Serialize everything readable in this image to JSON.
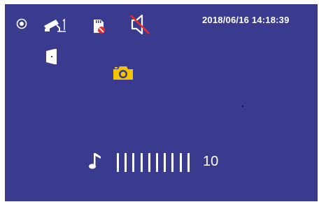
{
  "status_bar": {
    "timestamp": "2018/06/16 14:18:39",
    "icons": [
      "record-indicator-icon",
      "camera-1-icon",
      "sd-card-missing-icon",
      "speaker-muted-icon"
    ],
    "colors": {
      "background": "#3a3a8f",
      "foreground": "#ffffff",
      "alert": "#e03030",
      "snapshot": "#f5c400"
    }
  },
  "main": {
    "icons": [
      "door-unlock-icon",
      "snapshot-camera-icon",
      "music-note-icon"
    ]
  },
  "volume": {
    "level": 10,
    "max_level": 10,
    "level_label": "10"
  }
}
